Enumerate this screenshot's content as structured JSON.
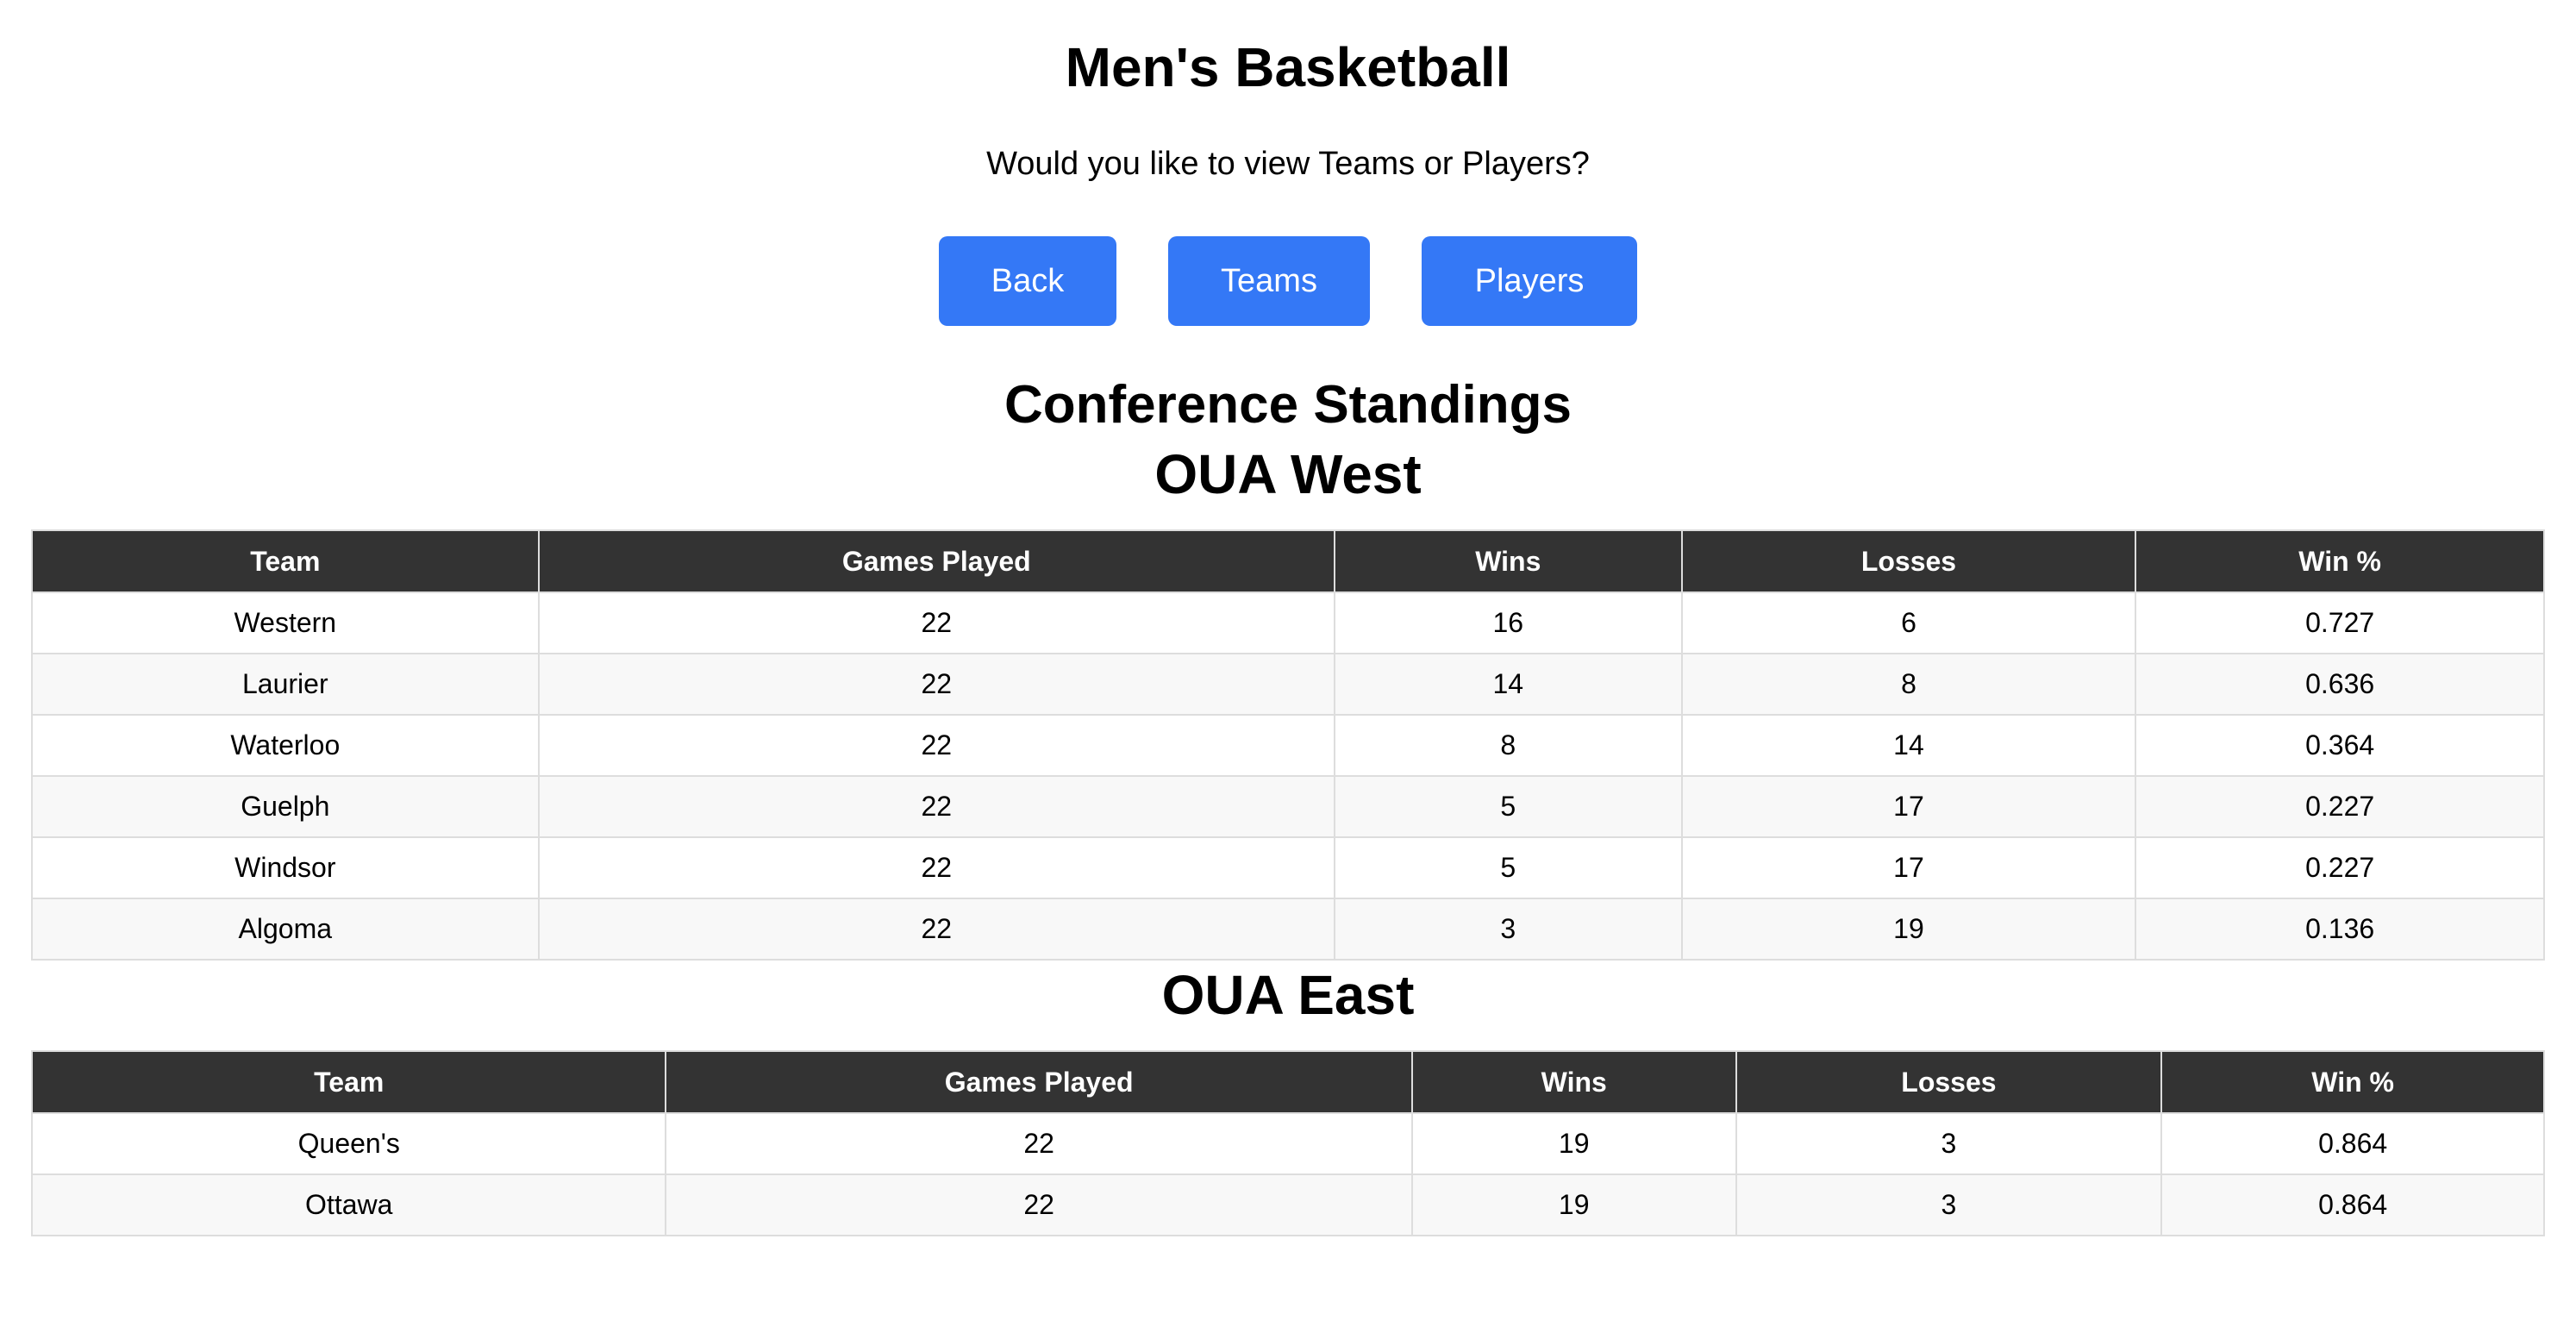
{
  "header": {
    "title": "Men's Basketball",
    "prompt": "Would you like to view Teams or Players?"
  },
  "buttons": {
    "back": "Back",
    "teams": "Teams",
    "players": "Players"
  },
  "colors": {
    "button_bg": "#3478f6",
    "table_header_bg": "#333333",
    "row_alt_bg": "#f8f8f8"
  },
  "standings": {
    "title": "Conference Standings",
    "columns": [
      "Team",
      "Games Played",
      "Wins",
      "Losses",
      "Win %"
    ],
    "west": {
      "title": "OUA West",
      "rows": [
        [
          "Western",
          "22",
          "16",
          "6",
          "0.727"
        ],
        [
          "Laurier",
          "22",
          "14",
          "8",
          "0.636"
        ],
        [
          "Waterloo",
          "22",
          "8",
          "14",
          "0.364"
        ],
        [
          "Guelph",
          "22",
          "5",
          "17",
          "0.227"
        ],
        [
          "Windsor",
          "22",
          "5",
          "17",
          "0.227"
        ],
        [
          "Algoma",
          "22",
          "3",
          "19",
          "0.136"
        ]
      ]
    },
    "east": {
      "title": "OUA East",
      "rows": [
        [
          "Queen's",
          "22",
          "19",
          "3",
          "0.864"
        ],
        [
          "Ottawa",
          "22",
          "19",
          "3",
          "0.864"
        ]
      ]
    }
  }
}
